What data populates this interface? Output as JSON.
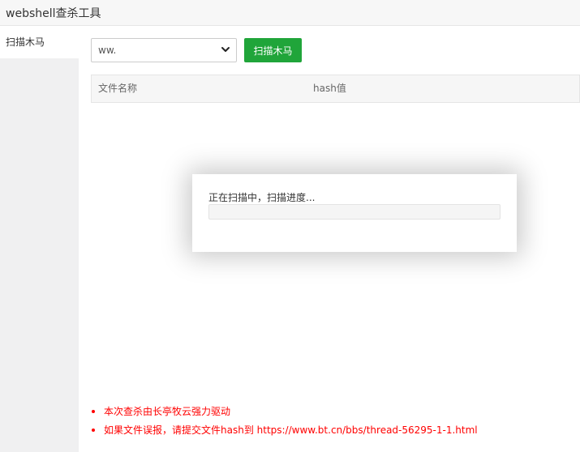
{
  "window": {
    "title": "webshell查杀工具"
  },
  "sidebar": {
    "items": [
      {
        "label": "扫描木马"
      }
    ]
  },
  "toolbar": {
    "site_select": {
      "value": "ww.",
      "options": [
        "ww."
      ]
    },
    "scan_button_label": "扫描木马"
  },
  "table": {
    "columns": [
      "文件名称",
      "hash值"
    ],
    "rows": []
  },
  "progress_dialog": {
    "status_text": "正在扫描中，扫描进度...",
    "progress": 0
  },
  "notes": [
    "本次查杀由长亭牧云强力驱动",
    "如果文件误报，请提交文件hash到 https://www.bt.cn/bbs/thread-56295-1-1.html"
  ],
  "colors": {
    "accent": "#20a53a",
    "note": "#ff0000"
  }
}
